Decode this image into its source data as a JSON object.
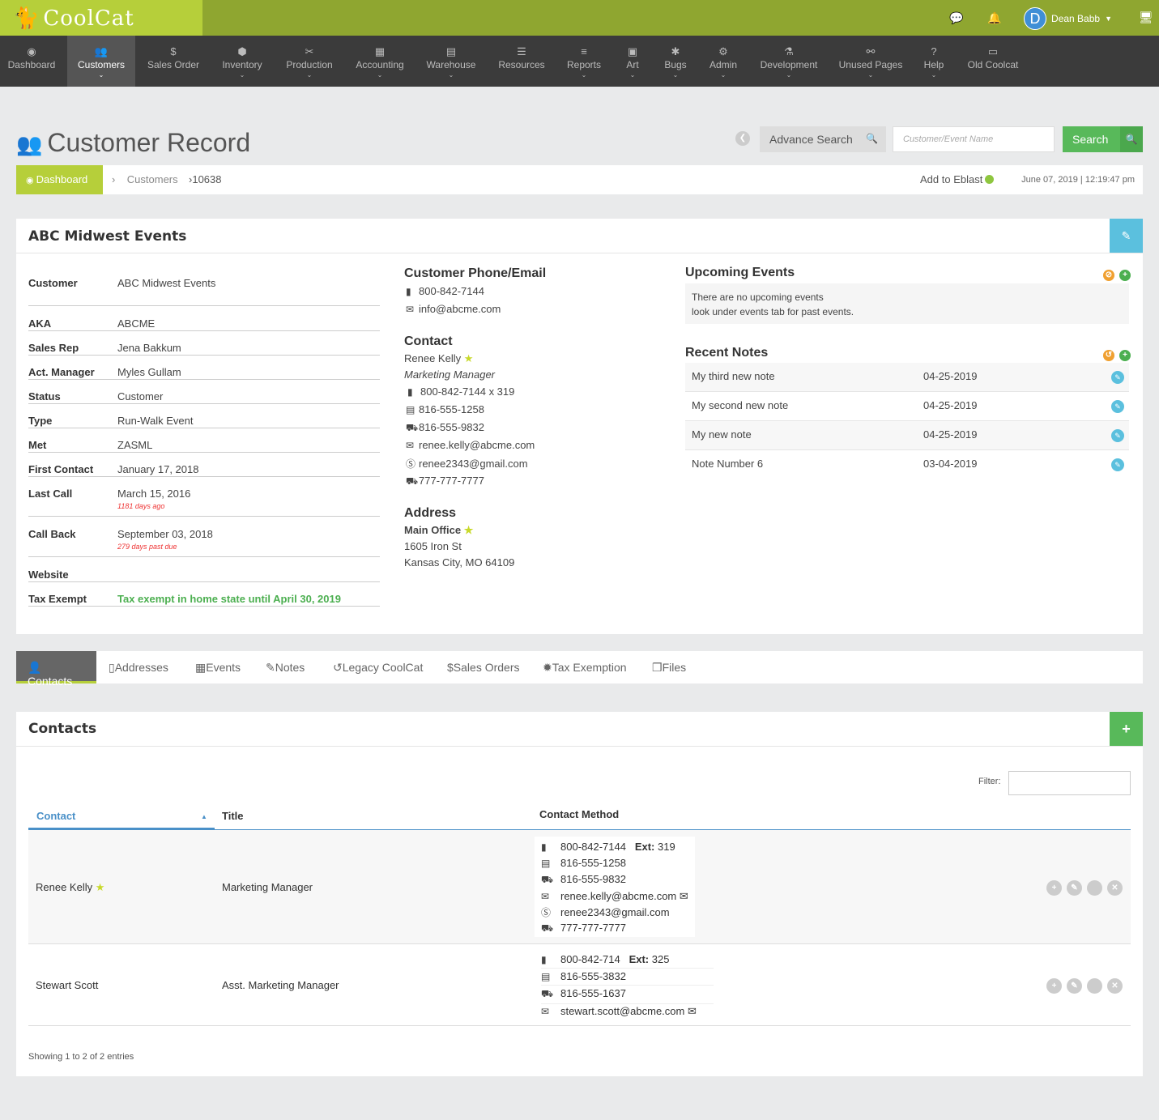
{
  "app": {
    "logo_text": "CoolCat"
  },
  "header": {
    "user_initial": "D",
    "user_name": "Dean Babb"
  },
  "nav": [
    {
      "label": "Dashboard",
      "icon": "dashboard-icon"
    },
    {
      "label": "Customers",
      "icon": "users-icon",
      "active": true
    },
    {
      "label": "Sales Order",
      "icon": "dollar-icon"
    },
    {
      "label": "Inventory",
      "icon": "cubes-icon"
    },
    {
      "label": "Production",
      "icon": "scissors-icon"
    },
    {
      "label": "Accounting",
      "icon": "calculator-icon"
    },
    {
      "label": "Warehouse",
      "icon": "building-icon"
    },
    {
      "label": "Resources",
      "icon": "database-icon"
    },
    {
      "label": "Reports",
      "icon": "list-icon"
    },
    {
      "label": "Art",
      "icon": "image-icon"
    },
    {
      "label": "Bugs",
      "icon": "bug-icon"
    },
    {
      "label": "Admin",
      "icon": "wrench-icon"
    },
    {
      "label": "Development",
      "icon": "flask-icon"
    },
    {
      "label": "Unused Pages",
      "icon": "unlink-icon"
    },
    {
      "label": "Help",
      "icon": "question-icon"
    },
    {
      "label": "Old Coolcat",
      "icon": "window-icon"
    }
  ],
  "page": {
    "title": "Customer Record"
  },
  "search": {
    "advanced_label": "Advance Search",
    "placeholder": "Customer/Event Name",
    "button": "Search"
  },
  "breadcrumb": {
    "home": "Dashboard",
    "customers": "Customers",
    "id": "10638",
    "eblast": "Add to Eblast",
    "datetime": "June 07, 2019 | 12:19:47 pm"
  },
  "customer": {
    "name": "ABC Midwest Events",
    "fields": [
      {
        "label": "Customer",
        "value": "ABC Midwest Events"
      },
      {
        "label": "AKA",
        "value": "ABCME"
      },
      {
        "label": "Sales Rep",
        "value": "Jena Bakkum"
      },
      {
        "label": "Act. Manager",
        "value": "Myles Gullam"
      },
      {
        "label": "Status",
        "value": "Customer"
      },
      {
        "label": "Type",
        "value": "Run-Walk Event"
      },
      {
        "label": "Met",
        "value": "ZASML"
      },
      {
        "label": "First Contact",
        "value": "January 17, 2018"
      },
      {
        "label": "Last Call",
        "value": "March 15, 2016",
        "sub": "1181 days ago"
      },
      {
        "label": "Call Back",
        "value": "September 03, 2018",
        "sub": "279 days past due"
      },
      {
        "label": "Website",
        "value": ""
      },
      {
        "label": "Tax Exempt",
        "value": "Tax exempt in home state until April 30, 2019"
      }
    ],
    "phone_email": {
      "title": "Customer Phone/Email",
      "phone": "800-842-7144",
      "email": "info@abcme.com"
    },
    "contact": {
      "title": "Contact",
      "name": "Renee Kelly",
      "role": "Marketing Manager",
      "methods": [
        "800-842-7144 x 319",
        "816-555-1258",
        "816-555-9832",
        "renee.kelly@abcme.com",
        "renee2343@gmail.com",
        "777-777-7777"
      ]
    },
    "address": {
      "title": "Address",
      "label": "Main Office",
      "line1": "1605 Iron St",
      "line2": "Kansas City, MO 64109"
    },
    "upcoming": {
      "title": "Upcoming Events",
      "line1": "There are no upcoming events",
      "line2": "look under events tab for past events."
    },
    "notes": {
      "title": "Recent Notes",
      "items": [
        {
          "text": "My third new note",
          "date": "04-25-2019"
        },
        {
          "text": "My second new note",
          "date": "04-25-2019"
        },
        {
          "text": "My new note",
          "date": "04-25-2019"
        },
        {
          "text": "Note Number 6",
          "date": "03-04-2019"
        }
      ]
    }
  },
  "tabs": [
    {
      "label": "Contacts",
      "icon": "user-icon",
      "active": true
    },
    {
      "label": "Addresses",
      "icon": "building-icon"
    },
    {
      "label": "Events",
      "icon": "calendar-icon"
    },
    {
      "label": "Notes",
      "icon": "edit-icon"
    },
    {
      "label": "Legacy CoolCat",
      "icon": "history-icon"
    },
    {
      "label": "Sales Orders",
      "icon": "dollar-icon"
    },
    {
      "label": "Tax Exemption",
      "icon": "certificate-icon"
    },
    {
      "label": "Files",
      "icon": "files-icon"
    }
  ],
  "contacts": {
    "title": "Contacts",
    "filter_label": "Filter:",
    "columns": [
      "Contact",
      "Title",
      "Contact Method"
    ],
    "rows": [
      {
        "name": "Renee Kelly",
        "title": "Marketing Manager",
        "methods": [
          {
            "value": "800-842-7144",
            "ext": "319"
          },
          {
            "value": "816-555-1258"
          },
          {
            "value": "816-555-9832"
          },
          {
            "value": "renee.kelly@abcme.com"
          },
          {
            "value": "renee2343@gmail.com"
          },
          {
            "value": "777-777-7777"
          }
        ]
      },
      {
        "name": "Stewart Scott",
        "title": "Asst. Marketing Manager",
        "methods": [
          {
            "value": "800-842-714",
            "ext": "325"
          },
          {
            "value": "816-555-3832"
          },
          {
            "value": "816-555-1637"
          },
          {
            "value": "stewart.scott@abcme.com"
          }
        ]
      }
    ],
    "ext_label": "Ext:",
    "footer": "Showing 1 to 2 of 2 entries"
  },
  "colors": {
    "brand_green": "#8fa630",
    "brand_light": "#b6cf3a",
    "search_green": "#58b95a",
    "info_blue": "#5bc0de"
  }
}
